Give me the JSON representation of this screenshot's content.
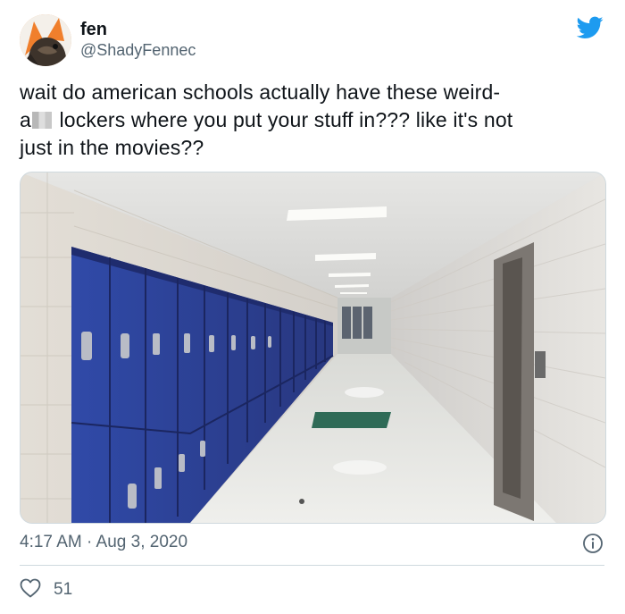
{
  "user": {
    "display_name": "fen",
    "handle": "@ShadyFennec"
  },
  "tweet": {
    "line1": "wait do american schools actually have these weird-",
    "line2_pre": "a",
    "line2_post": " lockers where you put your stuff in??? like it's not",
    "line3": "just in the movies??"
  },
  "meta": {
    "timestamp": "4:17 AM · Aug 3, 2020",
    "likes": "51"
  },
  "icons": {
    "logo": "twitter-bird-icon",
    "info": "info-icon",
    "like": "heart-outline-icon"
  },
  "colors": {
    "twitter_blue": "#1d9bf0",
    "text": "#0f1419",
    "muted": "#536471",
    "locker_blue": "#2c3f9c"
  }
}
